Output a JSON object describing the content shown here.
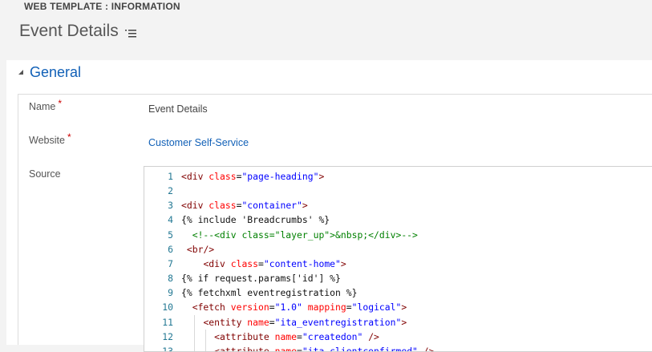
{
  "header": {
    "entity_type": "WEB TEMPLATE : INFORMATION",
    "record_title": "Event Details"
  },
  "section": {
    "title": "General"
  },
  "fields": {
    "name": {
      "label": "Name",
      "required_marker": "*",
      "value": "Event Details"
    },
    "website": {
      "label": "Website",
      "required_marker": "*",
      "value": "Customer Self-Service"
    },
    "source": {
      "label": "Source"
    }
  },
  "code_lines": [
    {
      "n": "1",
      "text": "<div class=\"page-heading\">"
    },
    {
      "n": "2",
      "text": ""
    },
    {
      "n": "3",
      "text": "<div class=\"container\">"
    },
    {
      "n": "4",
      "text": "{% include 'Breadcrumbs' %}"
    },
    {
      "n": "5",
      "text": "  <!--<div class=\"layer_up\">&nbsp;</div>-->"
    },
    {
      "n": "6",
      "text": " <br/>"
    },
    {
      "n": "7",
      "text": "    <div class=\"content-home\">"
    },
    {
      "n": "8",
      "text": "{% if request.params['id'] %}"
    },
    {
      "n": "9",
      "text": "{% fetchxml eventregistration %}"
    },
    {
      "n": "10",
      "text": "  <fetch version=\"1.0\" mapping=\"logical\">"
    },
    {
      "n": "11",
      "text": "    <entity name=\"ita_eventregistration\">"
    },
    {
      "n": "12",
      "text": "      <attribute name=\"createdon\" />"
    },
    {
      "n": "13",
      "text": "      <attribute name=\"ita_clientconfirmed\" />"
    }
  ],
  "colors": {
    "accent_link": "#1160b7",
    "required": "#cc0000",
    "line_number": "#237893",
    "tag": "#800000",
    "attribute": "#ff0000",
    "string": "#0000ff",
    "comment": "#008000"
  }
}
